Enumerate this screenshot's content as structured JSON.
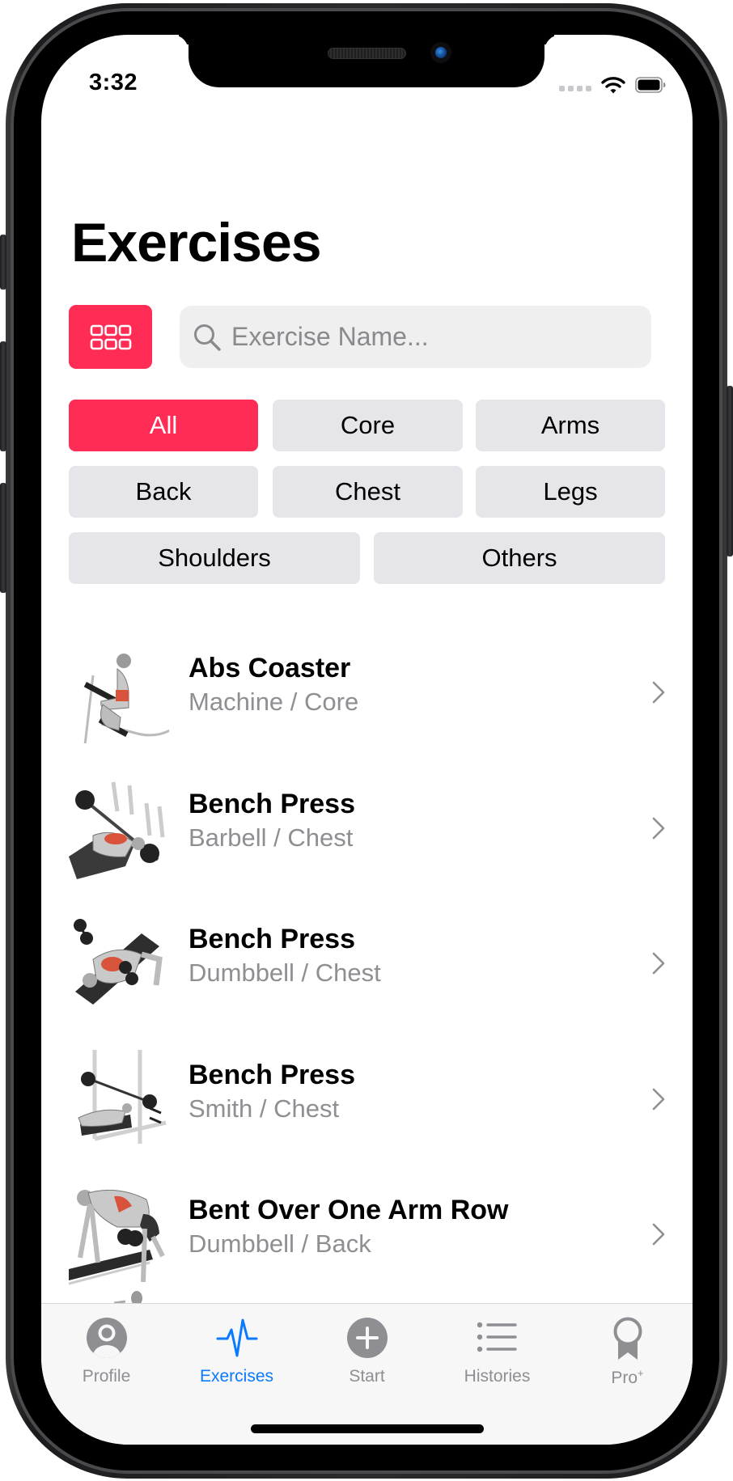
{
  "status_bar": {
    "time": "3:32",
    "signal_icon": "cellular-signal-dots-icon",
    "wifi_icon": "wifi-icon",
    "battery_icon": "battery-icon"
  },
  "header": {
    "title": "Exercises",
    "grid_button_icon": "grid-icon"
  },
  "search": {
    "icon": "search-icon",
    "placeholder": "Exercise Name...",
    "value": ""
  },
  "filters": {
    "selected": "All",
    "items": [
      {
        "label": "All"
      },
      {
        "label": "Core"
      },
      {
        "label": "Arms"
      },
      {
        "label": "Back"
      },
      {
        "label": "Chest"
      },
      {
        "label": "Legs"
      },
      {
        "label": "Shoulders"
      },
      {
        "label": "Others"
      }
    ]
  },
  "exercises": [
    {
      "name": "Abs Coaster",
      "subtitle": "Machine / Core",
      "equipment": "Machine",
      "muscle": "Core"
    },
    {
      "name": "Bench Press",
      "subtitle": "Barbell / Chest",
      "equipment": "Barbell",
      "muscle": "Chest"
    },
    {
      "name": "Bench Press",
      "subtitle": "Dumbbell / Chest",
      "equipment": "Dumbbell",
      "muscle": "Chest"
    },
    {
      "name": "Bench Press",
      "subtitle": "Smith / Chest",
      "equipment": "Smith",
      "muscle": "Chest"
    },
    {
      "name": "Bent Over One Arm Row",
      "subtitle": "Dumbbell / Back",
      "equipment": "Dumbbell",
      "muscle": "Back"
    }
  ],
  "tabbar": {
    "active": "Exercises",
    "tabs": [
      {
        "label": "Profile",
        "icon": "profile-icon"
      },
      {
        "label": "Exercises",
        "icon": "heartbeat-icon"
      },
      {
        "label": "Start",
        "icon": "plus-circle-icon"
      },
      {
        "label": "Histories",
        "icon": "list-icon"
      },
      {
        "label": "Pro",
        "label_suffix": "+",
        "icon": "award-ribbon-icon"
      }
    ]
  },
  "colors": {
    "accent": "#ff2d55",
    "tab_active": "#0a7aff",
    "tab_inactive": "#8e8e93",
    "chip_bg": "#e5e5ea",
    "secondary_text": "#8e8e93"
  }
}
